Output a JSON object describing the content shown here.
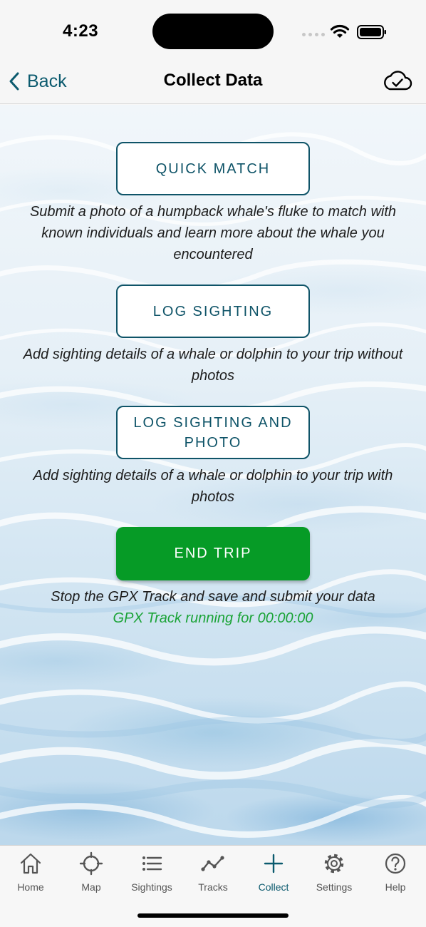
{
  "status": {
    "time": "4:23"
  },
  "nav": {
    "back_label": "Back",
    "title": "Collect Data"
  },
  "actions": {
    "quick_match": {
      "label": "QUICK MATCH",
      "description": "Submit a photo of a humpback whale's fluke to match with known individuals and learn more about the whale you encountered"
    },
    "log_sighting": {
      "label": "LOG SIGHTING",
      "description": "Add sighting details of a whale or dolphin to your trip without photos"
    },
    "log_sighting_photo": {
      "label": "LOG SIGHTING AND PHOTO",
      "description": "Add sighting details of a whale or dolphin to your trip with photos"
    },
    "end_trip": {
      "label": "END TRIP",
      "description": "Stop the GPX Track and save and submit your data",
      "status": "GPX Track running for 00:00:00"
    }
  },
  "tabs": [
    {
      "label": "Home",
      "icon": "home-icon"
    },
    {
      "label": "Map",
      "icon": "crosshair-icon"
    },
    {
      "label": "Sightings",
      "icon": "list-icon"
    },
    {
      "label": "Tracks",
      "icon": "chart-line-icon"
    },
    {
      "label": "Collect",
      "icon": "plus-icon",
      "active": true
    },
    {
      "label": "Settings",
      "icon": "gear-icon"
    },
    {
      "label": "Help",
      "icon": "help-icon"
    }
  ],
  "colors": {
    "accent": "#0f5468",
    "end_trip": "#069b26",
    "gpx_status": "#1aa336"
  }
}
